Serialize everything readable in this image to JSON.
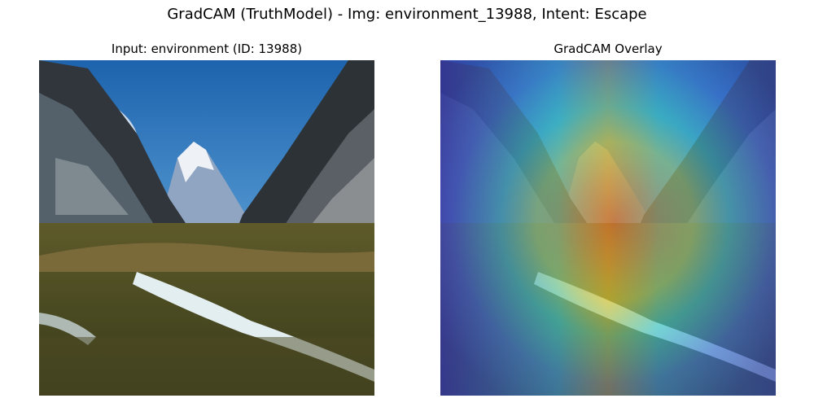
{
  "figure": {
    "title": "GradCAM (TruthModel) - Img: environment_13988, Intent: Escape"
  },
  "panels": [
    {
      "title": "Input: environment (ID: 13988)",
      "content": "mountain valley photo"
    },
    {
      "title": "GradCAM Overlay",
      "content": "heatmap over mountain valley photo"
    }
  ],
  "colors": {
    "sky_top": "#1f6fb8",
    "sky_bottom": "#8ec3e8",
    "mountain_dark": "#2b2f33",
    "snow": "#d8dde6",
    "meadow": "#6d6a2c",
    "river": "#e6f2f4",
    "heat_red": "#c9381f",
    "heat_yellow": "#d8c535",
    "heat_blue": "#3b3fc0"
  }
}
